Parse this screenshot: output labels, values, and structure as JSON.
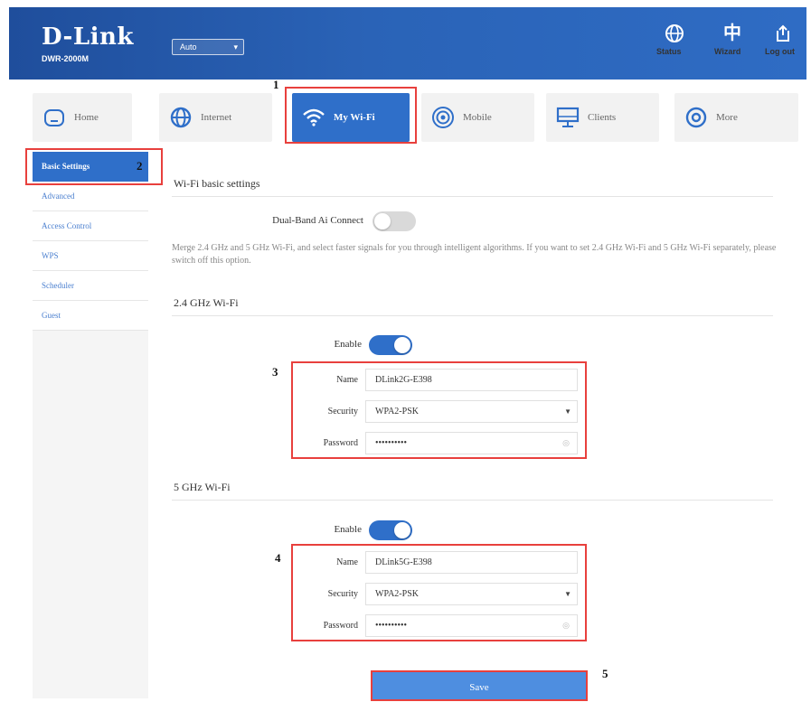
{
  "header": {
    "logo": "D-Link",
    "model": "DWR-2000M",
    "language": "Auto",
    "buttons": [
      {
        "label": "Status",
        "icon": "globe-icon"
      },
      {
        "label": "Wizard",
        "icon": "language-icon"
      },
      {
        "label": "Log out",
        "icon": "logout-icon"
      }
    ]
  },
  "nav": [
    {
      "label": "Home",
      "icon": "home-icon"
    },
    {
      "label": "Internet",
      "icon": "globe-icon"
    },
    {
      "label": "My Wi-Fi",
      "icon": "wifi-icon"
    },
    {
      "label": "Mobile",
      "icon": "signal-icon"
    },
    {
      "label": "Clients",
      "icon": "monitor-icon"
    },
    {
      "label": "More",
      "icon": "settings-icon"
    }
  ],
  "sidebar": [
    {
      "label": "Basic Settings"
    },
    {
      "label": "Advanced"
    },
    {
      "label": "Access Control"
    },
    {
      "label": "WPS"
    },
    {
      "label": "Scheduler"
    },
    {
      "label": "Guest"
    }
  ],
  "callouts": [
    "1",
    "2",
    "3",
    "4",
    "5"
  ],
  "main": {
    "title": "Wi-Fi basic settings",
    "dual_band_label": "Dual-Band Ai Connect",
    "dual_band_on": false,
    "dual_band_desc": "Merge 2.4 GHz and 5 GHz Wi-Fi, and select faster signals for you through intelligent algorithms. If you want to set 2.4 GHz Wi-Fi and 5 GHz Wi-Fi separately, please switch off this option.",
    "band24": {
      "title": "2.4 GHz Wi-Fi",
      "enable_label": "Enable",
      "enabled": true,
      "name_label": "Name",
      "name_value": "DLink2G-E398",
      "security_label": "Security",
      "security_value": "WPA2-PSK",
      "password_label": "Password",
      "password_value": "••••••••••"
    },
    "band5": {
      "title": "5 GHz Wi-Fi",
      "enable_label": "Enable",
      "enabled": true,
      "name_label": "Name",
      "name_value": "DLink5G-E398",
      "security_label": "Security",
      "security_value": "WPA2-PSK",
      "password_label": "Password",
      "password_value": "••••••••••"
    },
    "save_label": "Save"
  },
  "colors": {
    "brand": "#2f6fc9",
    "highlight": "#e8403d"
  }
}
